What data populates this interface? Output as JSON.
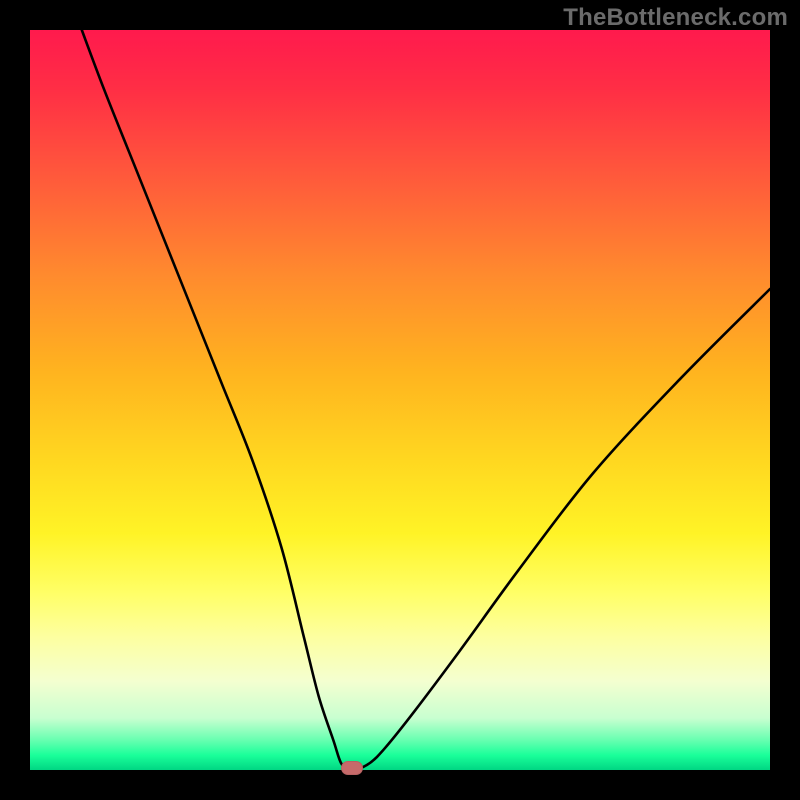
{
  "watermark": "TheBottleneck.com",
  "chart_data": {
    "type": "line",
    "title": "",
    "xlabel": "",
    "ylabel": "",
    "x_range": [
      0,
      100
    ],
    "y_range": [
      0,
      100
    ],
    "grid": false,
    "legend": false,
    "background": {
      "type": "vertical-gradient",
      "description": "red (top) through orange, yellow, pale yellow to green (bottom)",
      "stops": [
        {
          "pos": 0,
          "color": "#ff1a4d"
        },
        {
          "pos": 20,
          "color": "#ff5a3b"
        },
        {
          "pos": 46,
          "color": "#ffd720"
        },
        {
          "pos": 76,
          "color": "#ffff66"
        },
        {
          "pos": 96,
          "color": "#66ffb0"
        },
        {
          "pos": 100,
          "color": "#00d683"
        }
      ]
    },
    "series": [
      {
        "name": "bottleneck-curve",
        "color": "#000000",
        "x": [
          7,
          10,
          14,
          18,
          22,
          26,
          30,
          34,
          37,
          39,
          41,
          42,
          43,
          44,
          46,
          48,
          52,
          58,
          66,
          76,
          88,
          100
        ],
        "y": [
          100,
          92,
          82,
          72,
          62,
          52,
          42,
          30,
          18,
          10,
          4,
          1,
          0,
          0,
          1,
          3,
          8,
          16,
          27,
          40,
          53,
          65
        ]
      }
    ],
    "marker": {
      "name": "optimal-point",
      "x": 43.5,
      "y": 0,
      "color": "#c66a6a",
      "shape": "rounded-rect"
    }
  }
}
